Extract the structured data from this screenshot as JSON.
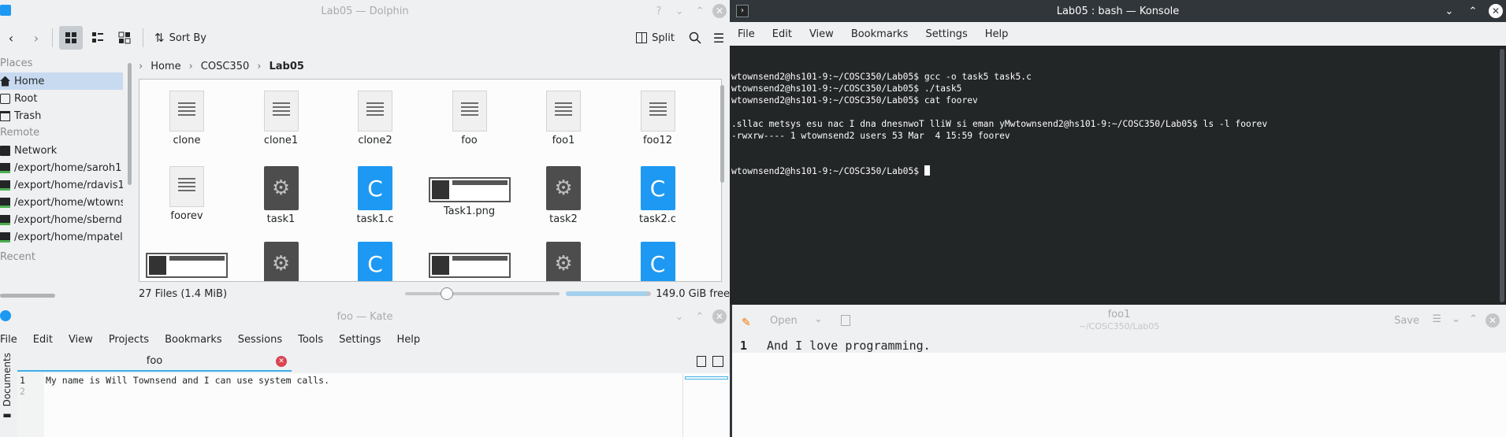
{
  "dolphin": {
    "title": "Lab05 — Dolphin",
    "toolbar": {
      "sort_label": "Sort By",
      "split_label": "Split"
    },
    "sidebar": {
      "places_header": "Places",
      "places": [
        {
          "label": "Home",
          "icon": "home-icon"
        },
        {
          "label": "Root",
          "icon": "drive-icon"
        },
        {
          "label": "Trash",
          "icon": "trash-icon"
        }
      ],
      "remote_header": "Remote",
      "remote": [
        {
          "label": "Network",
          "icon": "network-icon"
        },
        {
          "label": "/export/home/saroh1",
          "icon": "network-folder-icon"
        },
        {
          "label": "/export/home/rdavis1",
          "icon": "network-folder-icon"
        },
        {
          "label": "/export/home/wtowns",
          "icon": "network-folder-icon"
        },
        {
          "label": "/export/home/sberndl",
          "icon": "network-folder-icon"
        },
        {
          "label": "/export/home/mpatel",
          "icon": "network-folder-icon"
        }
      ],
      "recent_header": "Recent"
    },
    "breadcrumb": [
      "Home",
      "COSC350",
      "Lab05"
    ],
    "files": [
      {
        "name": "clone",
        "type": "doc"
      },
      {
        "name": "clone1",
        "type": "doc"
      },
      {
        "name": "clone2",
        "type": "doc"
      },
      {
        "name": "foo",
        "type": "doc"
      },
      {
        "name": "foo1",
        "type": "doc"
      },
      {
        "name": "foo12",
        "type": "doc"
      },
      {
        "name": "foorev",
        "type": "doc"
      },
      {
        "name": "task1",
        "type": "exe"
      },
      {
        "name": "task1.c",
        "type": "c"
      },
      {
        "name": "Task1.png",
        "type": "png"
      },
      {
        "name": "task2",
        "type": "exe"
      },
      {
        "name": "task2.c",
        "type": "c"
      }
    ],
    "status": {
      "file_count": "27 Files (1.4 MiB)",
      "free_space": "149.0 GiB free",
      "zoom_fraction": 0.25,
      "free_fraction": 0.95
    }
  },
  "konsole": {
    "title": "Lab05 : bash — Konsole",
    "menu": [
      "File",
      "Edit",
      "View",
      "Bookmarks",
      "Settings",
      "Help"
    ],
    "lines": [
      "wtownsend2@hs101-9:~/COSC350/Lab05$ gcc -o task5 task5.c",
      "wtownsend2@hs101-9:~/COSC350/Lab05$ ./task5",
      "wtownsend2@hs101-9:~/COSC350/Lab05$ cat foorev",
      "",
      ".sllac metsys esu nac I dna dnesnwoT lliW si eman yMwtownsend2@hs101-9:~/COSC350/Lab05$ ls -l foorev",
      "-rwxrw---- 1 wtownsend2 users 53 Mar  4 15:59 foorev"
    ],
    "prompt": "wtownsend2@hs101-9:~/COSC350/Lab05$ "
  },
  "kate": {
    "title": "foo — Kate",
    "menu": [
      "File",
      "Edit",
      "View",
      "Projects",
      "Bookmarks",
      "Sessions",
      "Tools",
      "Settings",
      "Help"
    ],
    "tab_label": "foo",
    "side_tab": "Documents",
    "line_numbers": [
      "1",
      "2"
    ],
    "line1": "My name is Will Townsend and I can use system calls."
  },
  "kwrite": {
    "open_label": "Open",
    "save_label": "Save",
    "doc_title": "foo1",
    "doc_path": "~/COSC350/Lab05",
    "line_number": "1",
    "line1": "And I love programming."
  }
}
